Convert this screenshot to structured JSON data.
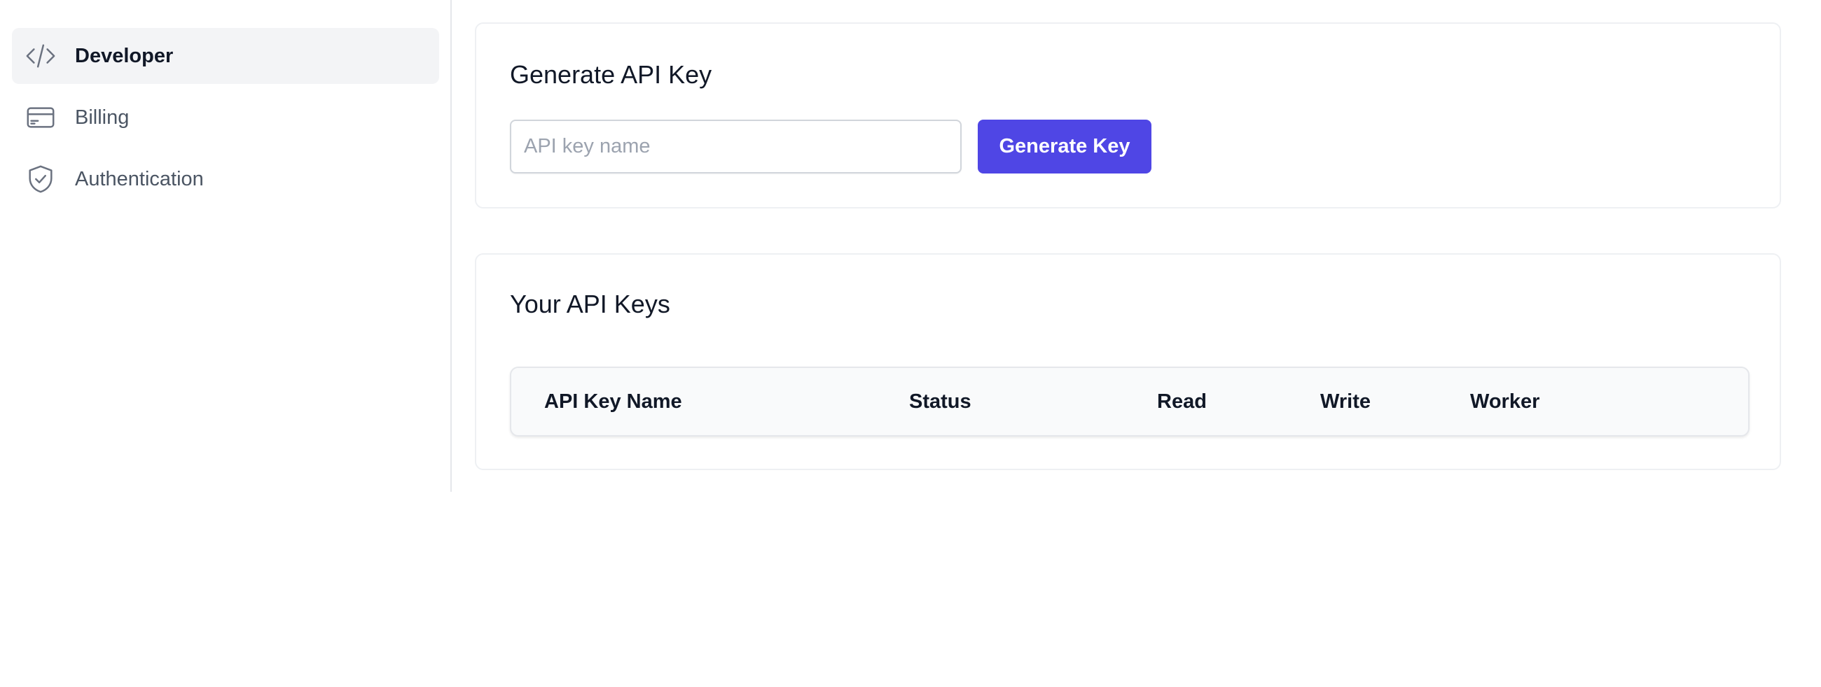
{
  "sidebar": {
    "items": [
      {
        "label": "Developer",
        "icon": "code-icon",
        "active": true
      },
      {
        "label": "Billing",
        "icon": "credit-card-icon",
        "active": false
      },
      {
        "label": "Authentication",
        "icon": "shield-check-icon",
        "active": false
      }
    ]
  },
  "generate": {
    "title": "Generate API Key",
    "input_placeholder": "API key name",
    "input_value": "",
    "button_label": "Generate Key"
  },
  "keys": {
    "title": "Your API Keys",
    "columns": [
      "API Key Name",
      "Status",
      "Read",
      "Write",
      "Worker"
    ],
    "rows": []
  },
  "colors": {
    "accent": "#4f46e5",
    "active_nav_bg": "#f3f4f6",
    "border": "#e5e7eb",
    "table_header_bg": "#f9fafb"
  }
}
